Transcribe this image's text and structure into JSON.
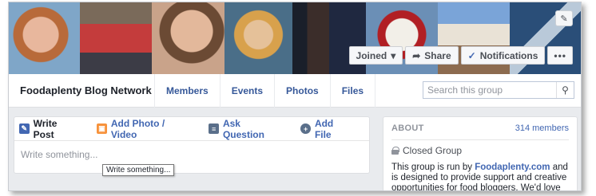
{
  "cover": {
    "buttons": {
      "joined": "Joined",
      "share": "Share",
      "notifications": "Notifications",
      "more": "•••"
    }
  },
  "nav": {
    "group_name": "Foodaplenty Blog Network",
    "tabs": [
      "Members",
      "Events",
      "Photos",
      "Files"
    ],
    "search_placeholder": "Search this group"
  },
  "composer": {
    "tabs": [
      "Write Post",
      "Add Photo / Video",
      "Ask Question",
      "Add File"
    ],
    "input_placeholder": "Write something...",
    "tooltip": "Write something..."
  },
  "about": {
    "title": "ABOUT",
    "members": "314 members",
    "privacy": "Closed Group",
    "description_prefix": "This group is run by ",
    "description_link": "Foodaplenty.com",
    "description_suffix": " and is designed to provide support and creative opportunities for food bloggers. We'd love to"
  },
  "colors": {
    "link": "#4267b2",
    "nav_link": "#365899",
    "background": "#e9ebee"
  }
}
